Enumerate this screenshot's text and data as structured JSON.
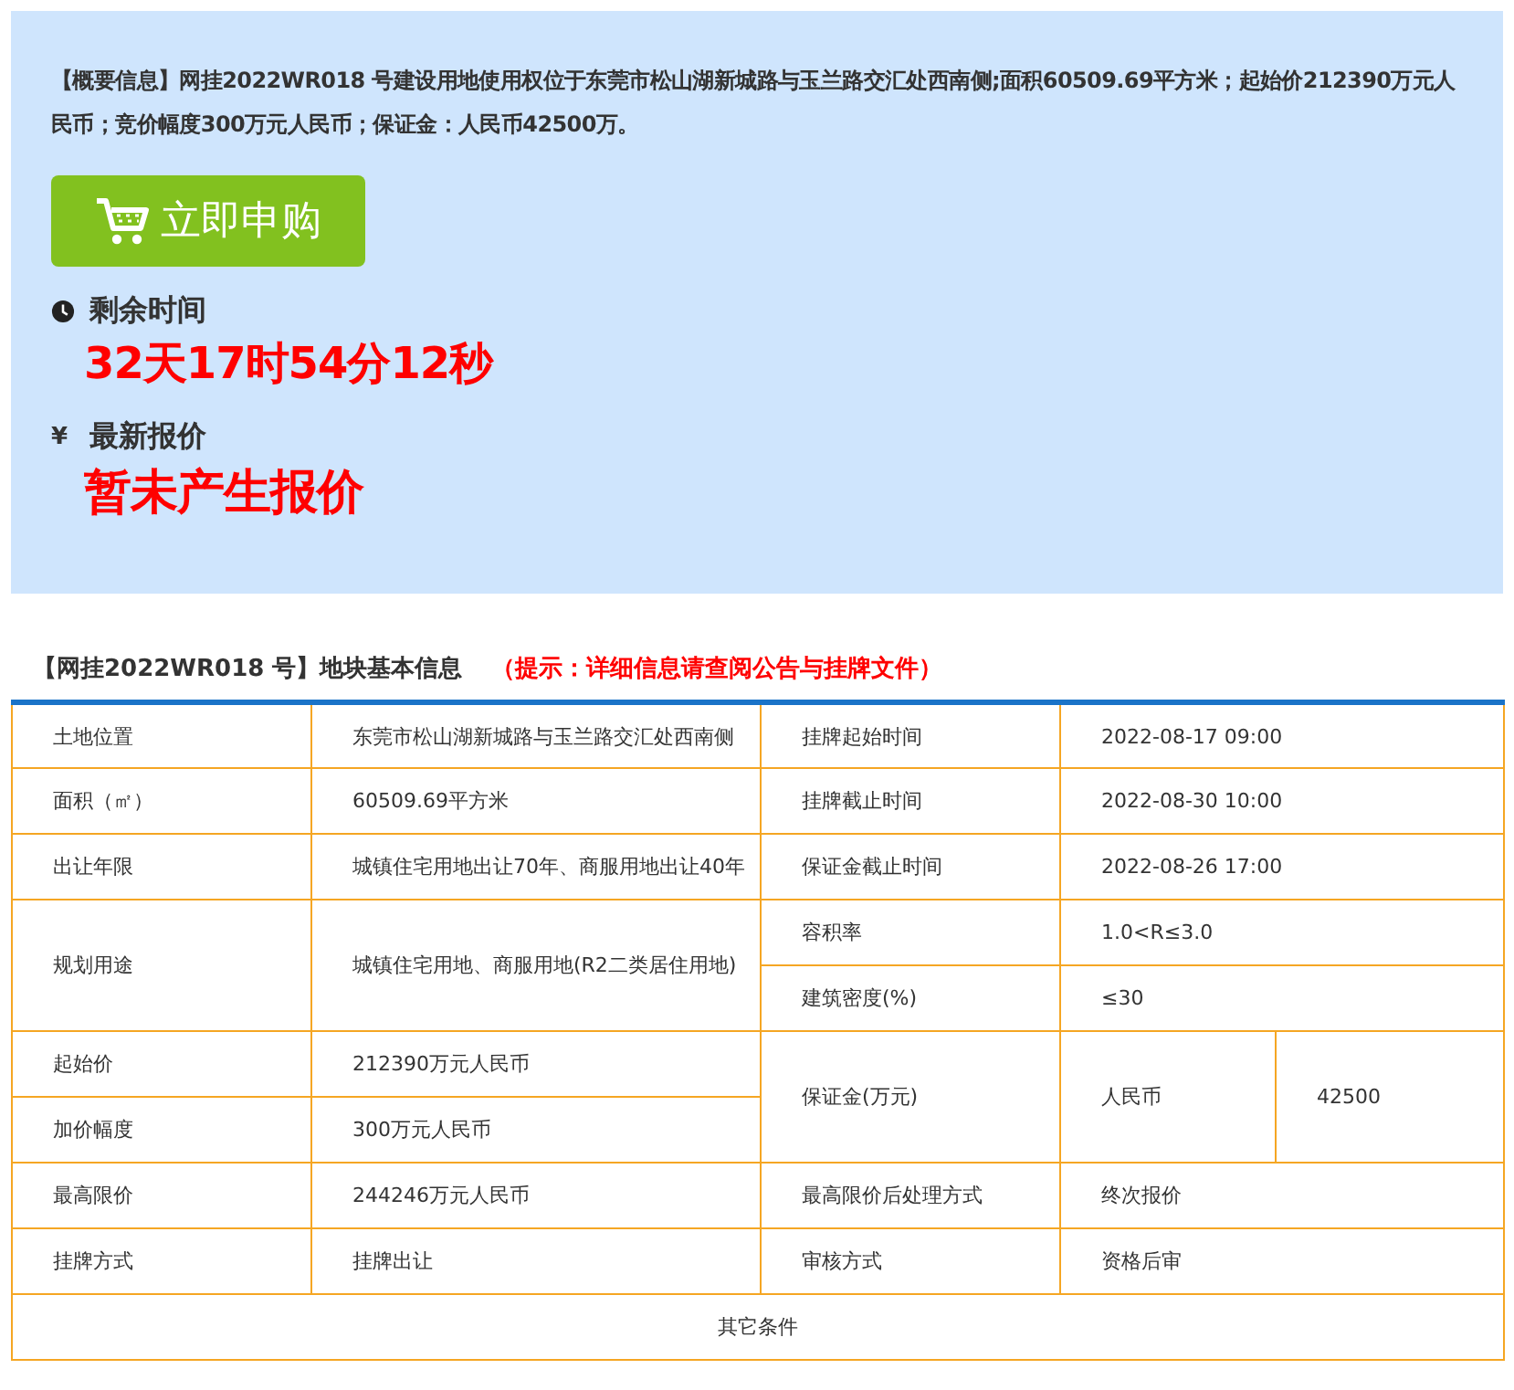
{
  "summary": "【概要信息】网挂2022WR018 号建设用地使用权位于东莞市松山湖新城路与玉兰路交汇处西南侧;面积60509.69平方米；起始价212390万元人民币；竞价幅度300万元人民币；保证金：人民币42500万。",
  "buy_button": {
    "label": "立即申购"
  },
  "countdown": {
    "label": "剩余时间",
    "value": "32天17时54分12秒"
  },
  "latest_bid": {
    "symbol": "¥",
    "label": "最新报价",
    "value": "暂未产生报价"
  },
  "section": {
    "title": "【网挂2022WR018 号】地块基本信息",
    "hint": "（提示：详细信息请查阅公告与挂牌文件）"
  },
  "table": {
    "rows": [
      [
        {
          "text": "土地位置",
          "kind": "label"
        },
        {
          "text": "东莞市松山湖新城路与玉兰路交汇处西南侧",
          "kind": "value"
        },
        {
          "text": "挂牌起始时间",
          "kind": "label"
        },
        {
          "text": "2022-08-17 09:00",
          "kind": "value",
          "colspan": 2
        }
      ],
      [
        {
          "text": "面积（㎡）",
          "kind": "label"
        },
        {
          "text": "60509.69平方米",
          "kind": "value"
        },
        {
          "text": "挂牌截止时间",
          "kind": "label"
        },
        {
          "text": "2022-08-30 10:00",
          "kind": "value",
          "colspan": 2
        }
      ],
      [
        {
          "text": "出让年限",
          "kind": "label"
        },
        {
          "text": "城镇住宅用地出让70年、商服用地出让40年",
          "kind": "value"
        },
        {
          "text": "保证金截止时间",
          "kind": "label"
        },
        {
          "text": "2022-08-26 17:00",
          "kind": "value",
          "colspan": 2
        }
      ],
      [
        {
          "text": "规划用途",
          "kind": "label",
          "rowspan": 2
        },
        {
          "text": "城镇住宅用地、商服用地(R2二类居住用地)",
          "kind": "value",
          "rowspan": 2
        },
        {
          "text": "容积率",
          "kind": "label"
        },
        {
          "text": "1.0<R≤3.0",
          "kind": "value",
          "colspan": 2
        }
      ],
      [
        {
          "text": "建筑密度(%)",
          "kind": "label"
        },
        {
          "text": "≤30",
          "kind": "value",
          "colspan": 2
        }
      ],
      [
        {
          "text": "起始价",
          "kind": "label"
        },
        {
          "text": "212390万元人民币",
          "kind": "value"
        },
        {
          "text": "保证金(万元)",
          "kind": "label",
          "rowspan": 2
        },
        {
          "text": "人民币",
          "kind": "value",
          "rowspan": 2
        },
        {
          "text": "42500",
          "kind": "value",
          "rowspan": 2
        }
      ],
      [
        {
          "text": "加价幅度",
          "kind": "label"
        },
        {
          "text": "300万元人民币",
          "kind": "value"
        }
      ],
      [
        {
          "text": "最高限价",
          "kind": "label"
        },
        {
          "text": "244246万元人民币",
          "kind": "value"
        },
        {
          "text": "最高限价后处理方式",
          "kind": "label"
        },
        {
          "text": "终次报价",
          "kind": "value",
          "colspan": 2
        }
      ],
      [
        {
          "text": "挂牌方式",
          "kind": "label"
        },
        {
          "text": "挂牌出让",
          "kind": "value"
        },
        {
          "text": "审核方式",
          "kind": "label"
        },
        {
          "text": "资格后审",
          "kind": "value",
          "colspan": 2
        }
      ],
      [
        {
          "text": "其它条件",
          "kind": "footer",
          "colspan": 5
        }
      ]
    ]
  }
}
